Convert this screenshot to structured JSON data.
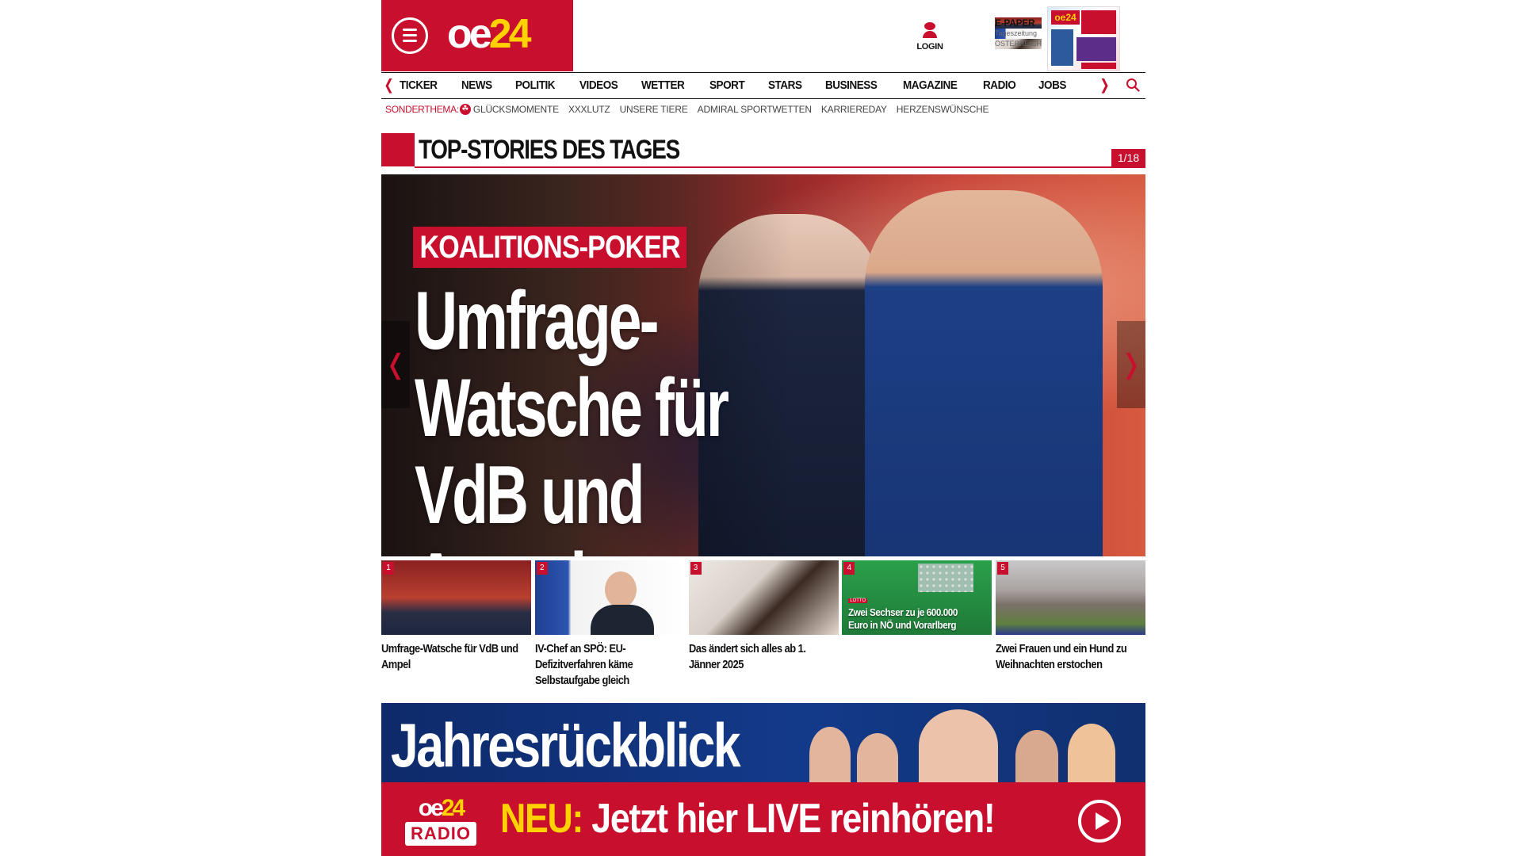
{
  "header": {
    "logo": {
      "prefix": "oe",
      "number": "24"
    },
    "login_label": "LOGIN",
    "epaper": {
      "title": "E-PAPER",
      "subtitle": "Tageszeitung",
      "region": "ÖSTERREICH"
    }
  },
  "nav": {
    "items": [
      "TICKER",
      "NEWS",
      "POLITIK",
      "VIDEOS",
      "WETTER",
      "SPORT",
      "STARS",
      "BUSINESS",
      "MAGAZINE",
      "RADIO",
      "JOBS"
    ]
  },
  "sonderthema": {
    "label": "SONDERTHEMA:",
    "links": [
      "GLÜCKSMOMENTE",
      "XXXLUTZ",
      "UNSERE TIERE",
      "ADMIRAL SPORTWETTEN",
      "KARRIEREDAY",
      "HERZENSWÜNSCHE"
    ]
  },
  "top_stories": {
    "title": "TOP-STORIES DES TAGES",
    "counter": "1/18"
  },
  "hero": {
    "kicker": "KOALITIONS-POKER",
    "headline": "Umfrage-Watsche für VdB und Ampel"
  },
  "thumbs": [
    {
      "num": "1",
      "caption": "Umfrage-Watsche für VdB und Ampel",
      "overlay": ""
    },
    {
      "num": "2",
      "caption": "IV-Chef an SPÖ: EU-Defizitverfahren käme Selbstaufgabe gleich",
      "overlay": ""
    },
    {
      "num": "3",
      "caption": "Das ändert sich alles ab 1. Jänner 2025",
      "overlay": ""
    },
    {
      "num": "4",
      "caption": "",
      "overlay": "Zwei Sechser zu je 600.000 Euro in NÖ und Vorarlberg",
      "badge": "LOTTO"
    },
    {
      "num": "5",
      "caption": "Zwei Frauen und ein Hund zu Weihnachten erstochen",
      "overlay": ""
    }
  ],
  "banner": {
    "title": "Jahresrückblick",
    "radio_logo": {
      "prefix": "oe",
      "number": "24",
      "label": "RADIO"
    },
    "cta_highlight": "NEU:",
    "cta_text": "Jetzt hier LIVE reinhören!"
  },
  "colors": {
    "brand_red": "#c8102e",
    "brand_yellow": "#ffd200"
  },
  "icons": [
    "menu-icon",
    "user-icon",
    "search-icon",
    "chevron-left-icon",
    "chevron-right-icon",
    "play-icon",
    "clover-icon"
  ]
}
